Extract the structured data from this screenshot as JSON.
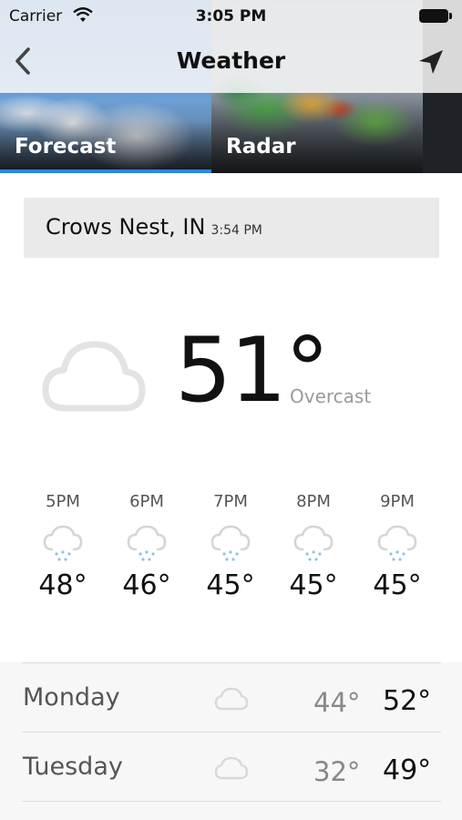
{
  "status_bar": {
    "carrier": "Carrier",
    "time": "3:05 PM"
  },
  "nav": {
    "title": "Weather",
    "back_icon": "chevron-left-icon",
    "location_icon": "location-arrow-icon"
  },
  "tabs": [
    {
      "label": "Forecast",
      "selected": true
    },
    {
      "label": "Radar",
      "selected": false
    }
  ],
  "location": {
    "name": "Crows Nest, IN",
    "updated": "3:54 PM"
  },
  "current": {
    "temp": "51°",
    "condition": "Overcast",
    "icon": "cloud-icon"
  },
  "hourly": [
    {
      "time": "5PM",
      "temp": "48°",
      "icon": "rain-cloud-icon"
    },
    {
      "time": "6PM",
      "temp": "46°",
      "icon": "rain-cloud-icon"
    },
    {
      "time": "7PM",
      "temp": "45°",
      "icon": "rain-cloud-icon"
    },
    {
      "time": "8PM",
      "temp": "45°",
      "icon": "rain-cloud-icon"
    },
    {
      "time": "9PM",
      "temp": "45°",
      "icon": "rain-cloud-icon"
    }
  ],
  "daily": [
    {
      "day": "Monday",
      "low": "44°",
      "high": "52°",
      "icon": "cloud-icon"
    },
    {
      "day": "Tuesday",
      "low": "32°",
      "high": "49°",
      "icon": "cloud-icon"
    }
  ],
  "colors": {
    "accent": "#2b86e8"
  }
}
